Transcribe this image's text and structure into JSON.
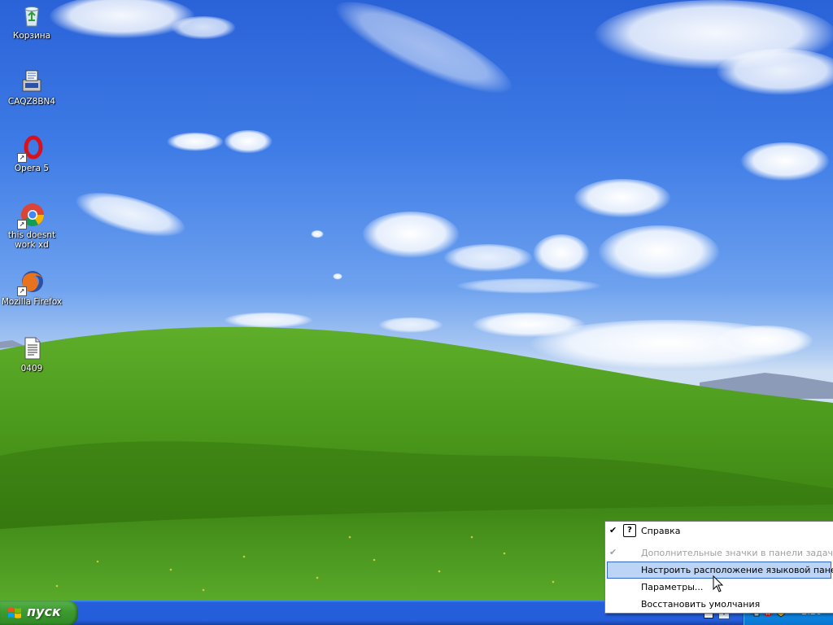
{
  "desktop": {
    "icons": [
      {
        "label": "Корзина",
        "icon": "recycle-bin-icon"
      },
      {
        "label": "CAQZ8BN4",
        "icon": "installer-icon"
      },
      {
        "label": "Opera 5",
        "icon": "opera-icon"
      },
      {
        "label": "this doesnt work xd",
        "icon": "chrome-icon"
      },
      {
        "label": "Mozilla Firefox",
        "icon": "firefox-icon"
      },
      {
        "label": "0409",
        "icon": "text-document-icon"
      }
    ]
  },
  "taskbar": {
    "start_label": "пуск",
    "clock": "2:26"
  },
  "context_menu": {
    "items": [
      {
        "label": "Справка",
        "checked": true,
        "disabled": false,
        "selected": false
      },
      {
        "label": "Дополнительные значки в панели задач",
        "checked": true,
        "disabled": true,
        "selected": false
      },
      {
        "label": "Настроить расположение языковой панели",
        "checked": false,
        "disabled": false,
        "selected": true
      },
      {
        "label": "Параметры...",
        "checked": false,
        "disabled": false,
        "selected": false
      },
      {
        "label": "Восстановить умолчания",
        "checked": false,
        "disabled": false,
        "selected": false
      }
    ]
  },
  "colors": {
    "sky": "#3f7ce6",
    "grass": "#4a9a1c",
    "taskbar": "#245edb",
    "start_button": "#3c9a2f",
    "tray": "#0c8ae8",
    "menu_highlight": "#bcd4f6"
  }
}
